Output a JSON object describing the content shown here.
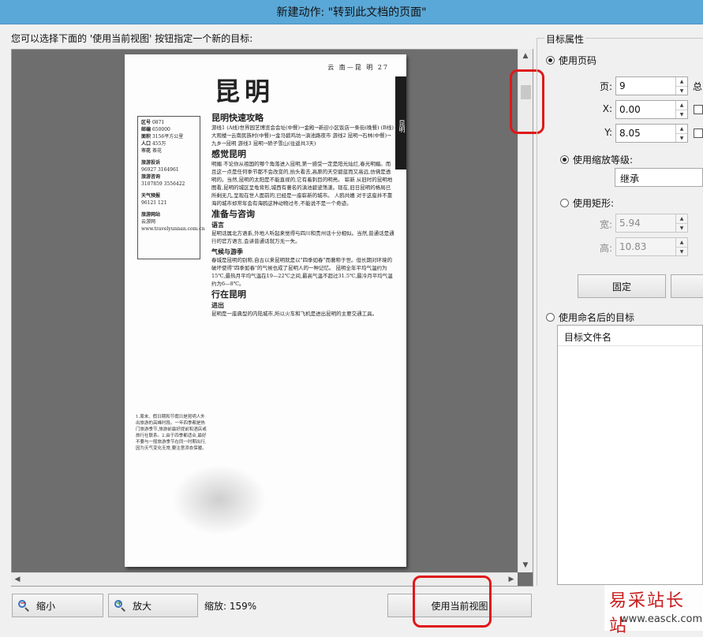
{
  "window": {
    "title": "新建动作: \"转到此文档的页面\""
  },
  "instruction": "您可以选择下面的 '使用当前视图' 按钮指定一个新的目标:",
  "document_page": {
    "running_head": "云 南—昆 明    27",
    "side_tab": "昆明",
    "city_title": "昆明",
    "info_box": [
      {
        "k": "区号",
        "v": "0871"
      },
      {
        "k": "邮编",
        "v": "650000"
      },
      {
        "k": "面积",
        "v": "3156平方公里"
      },
      {
        "k": "人口",
        "v": "455万"
      },
      {
        "k": "市花",
        "v": "茶花"
      },
      {
        "k": "旅游投诉",
        "v": "96927 3164961"
      },
      {
        "k": "旅游咨询",
        "v": "3107859 3556422"
      },
      {
        "k": "天气预报",
        "v": "96121 121"
      },
      {
        "k": "旅游网站",
        "v": "云游网 www.travelyunnan.com.cn"
      }
    ],
    "sections": [
      {
        "heading": "昆明快速攻略",
        "text": "游线1 (A线)世界园艺博览会会址(中餐)→金殿→新迎小区饭店一条街(晚餐)  (B线)大观楼→云南民族村(中餐)→金马碧鸡坊→滇池路夜市  游线2 昆明→石林(中餐)→九乡→昆明  游线3 昆明→轿子雪山(往返共3天)"
      },
      {
        "heading": "感觉昆明",
        "text": "明媚 不论你从祖国的哪个角落进入昆明,第一感受一定是阳光灿烂,春光明媚。而且这一点是任何季节都不会改变的,抬头看去,高原的天空碧蓝而又高远,仿佛是透明的。当然,昆明的太阳是不能直视的,它有着刺目的明亮。 崭新 从旧时的昆明地图看,昆明的城区呈龟背形,城西有著名的滇池碧波荡漾。现在,旧日昆明的格局已所剩无几,呈现在世人面前的,已经是一座崭新的城市。 人鸥共嬉 对于这座并不靠海的城市却常年会有海鸥这种动物过冬,不能说不是一个奇迹。"
      },
      {
        "heading": "准备与咨询",
        "text": ""
      },
      {
        "heading": "语言",
        "text": "昆明话属北方语系,外地人听起来觉得与四川和贵州话十分相似。当然,普通话是通行的官方语言,会讲普通话就万无一失。"
      },
      {
        "heading": "气候与游季",
        "text": "春城是昆明的别称,自古以来昆明就是以\"四季如春\"而著称于世。但长期对环境的破坏使得\"四季如春\"的气候也成了昆明人的一种记忆。 昆明全年平均气温约为15℃,最热月平均气温在19—22℃之间,最高气温不超过31.5℃,最冷月平均气温约为6—8℃。"
      },
      {
        "heading": "行在昆明",
        "text": ""
      },
      {
        "heading": "进出",
        "text": "昆明是一座典型的内陆城市,所以火车和飞机是进出昆明的主要交通工具。"
      }
    ],
    "tip_text": "1.周末、假日期和节假日是昆明人外出旅游的高峰时段。一年四季都是热门旅游季节,旅游前最好提前和酒店或旅行社联系。2.由于四季都适合,最好不要与一般旅游季节在同一时期出行,因为天气变化无常,要注意添衣保暖。"
  },
  "bottom": {
    "zoom_out_label": "缩小",
    "zoom_in_label": "放大",
    "zoom_text": "缩放: 159%",
    "use_current_view_label": "使用当前视图"
  },
  "target_properties": {
    "group_title": "目标属性",
    "use_page_label": "使用页码",
    "page_label": "页:",
    "page_value": "9",
    "page_suffix": "总",
    "x_label": "X:",
    "x_value": "0.00",
    "y_label": "Y:",
    "y_value": "8.05",
    "use_zoom_label": "使用缩放等级:",
    "zoom_select_value": "继承",
    "use_rect_label": "使用矩形:",
    "width_label": "宽:",
    "width_value": "5.94",
    "height_label": "高:",
    "height_value": "10.83",
    "fixed_button_label": "固定",
    "use_named_label": "使用命名后的目标",
    "named_list_header": "目标文件名"
  },
  "watermark": {
    "brand": "易采站长站",
    "url": "www.easck.com"
  },
  "colors": {
    "titlebar": "#5aa8d8",
    "annotation_red": "#e01818",
    "preview_bg": "#6e6e6e"
  }
}
